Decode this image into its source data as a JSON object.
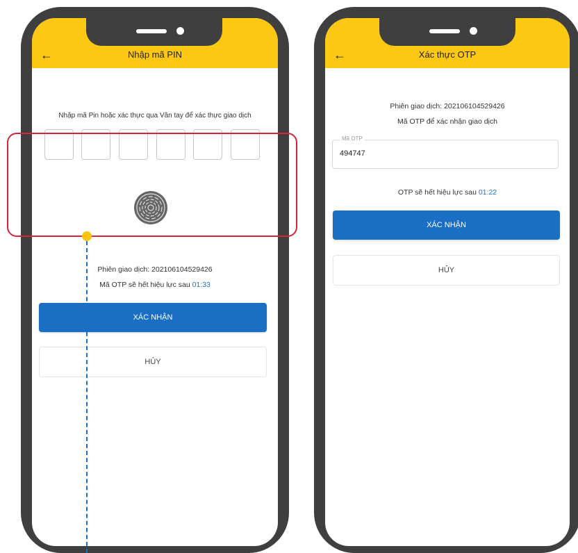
{
  "left_phone": {
    "header_title": "Nhập mã PIN",
    "back_icon": "←",
    "instruction": "Nhập mã Pin hoặc xác thực qua Vân tay để xác thực giao dịch",
    "pin_boxes": 6,
    "fingerprint_icon": "fingerprint-icon",
    "transaction_label": "Phiên giao dịch: 202106104529426",
    "otp_expiry_prefix": "Mã OTP sẽ hết hiệu lực sau",
    "otp_expiry_time": "01:33",
    "confirm_label": "XÁC NHẬN",
    "cancel_label": "HỦY"
  },
  "right_phone": {
    "header_title": "Xác thực OTP",
    "back_icon": "←",
    "transaction_label": "Phiên giao dịch: 202106104529426",
    "otp_purpose": "Mã OTP để xác nhận giao dịch",
    "otp_field_label": "Mã OTP",
    "otp_field_value": "494747",
    "otp_expiry_prefix": "OTP sẽ hết hiệu lực sau",
    "otp_expiry_time": "01:22",
    "confirm_label": "XÁC NHẬN",
    "cancel_label": "HỦY"
  },
  "colors": {
    "header": "#fdc813",
    "primary": "#1a6fc4",
    "highlight": "#d5253a",
    "frame": "#3f3f3f"
  }
}
